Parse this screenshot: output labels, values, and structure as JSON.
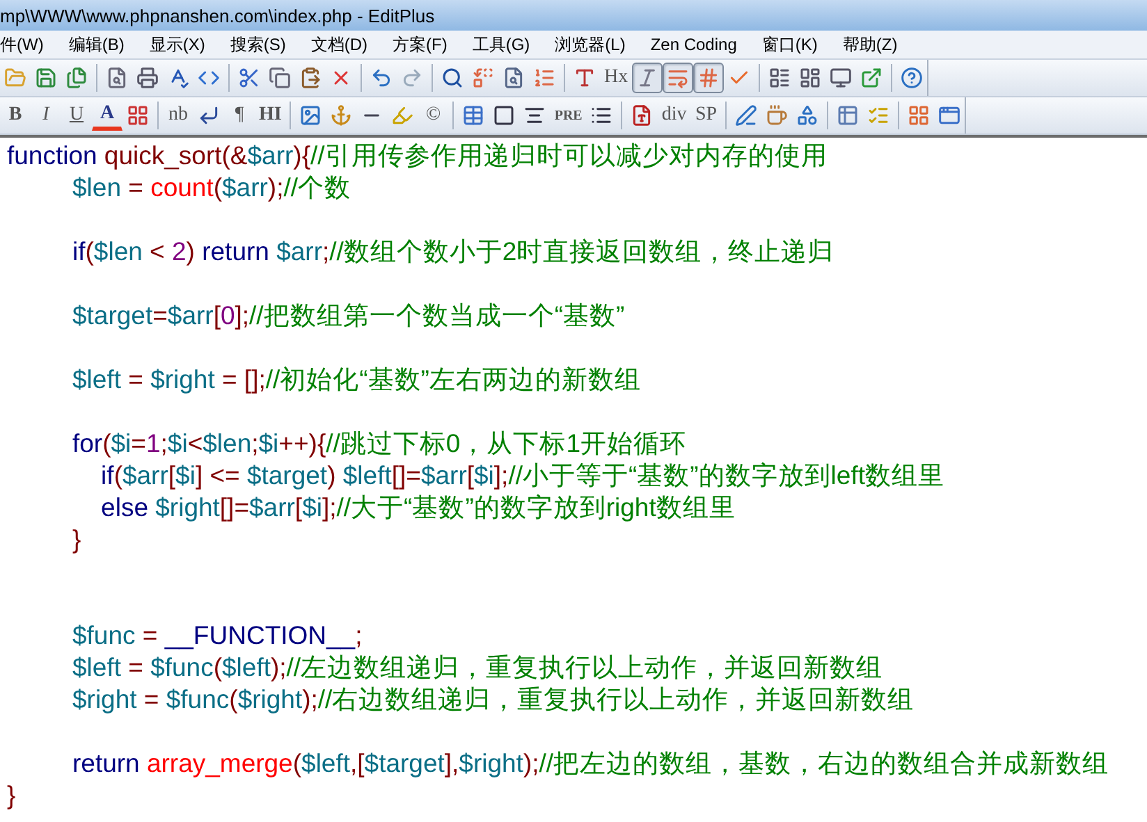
{
  "window": {
    "title": "mp\\WWW\\www.phpnanshen.com\\index.php - EditPlus"
  },
  "menu": [
    "件(W)",
    "编辑(B)",
    "显示(X)",
    "搜索(S)",
    "文档(D)",
    "方案(F)",
    "工具(G)",
    "浏览器(L)",
    "Zen Coding",
    "窗口(K)",
    "帮助(Z)"
  ],
  "toolbar_1": [
    {
      "kind": "icon"
    },
    {
      "kind": "icon"
    },
    {
      "kind": "icon"
    },
    {
      "kind": "sep"
    },
    {
      "kind": "icon"
    },
    {
      "kind": "icon"
    },
    {
      "kind": "icon"
    },
    {
      "kind": "icon"
    },
    {
      "kind": "sep"
    },
    {
      "kind": "icon"
    },
    {
      "kind": "icon"
    },
    {
      "kind": "icon"
    },
    {
      "kind": "icon"
    },
    {
      "kind": "sep"
    },
    {
      "kind": "icon"
    },
    {
      "kind": "icon"
    },
    {
      "kind": "sep"
    },
    {
      "kind": "icon"
    },
    {
      "kind": "icon"
    },
    {
      "kind": "icon"
    },
    {
      "kind": "icon"
    },
    {
      "kind": "sep"
    },
    {
      "kind": "icon"
    },
    {
      "kind": "text",
      "label": "Hx"
    },
    {
      "kind": "toggle",
      "selected": true
    },
    {
      "kind": "toggle",
      "selected": true
    },
    {
      "kind": "toggle",
      "selected": true
    },
    {
      "kind": "icon"
    },
    {
      "kind": "sep"
    },
    {
      "kind": "icon"
    },
    {
      "kind": "icon"
    },
    {
      "kind": "icon"
    },
    {
      "kind": "icon"
    },
    {
      "kind": "sep"
    },
    {
      "kind": "icon"
    }
  ],
  "toolbar_2": [
    {
      "kind": "text",
      "label": "B"
    },
    {
      "kind": "text",
      "label": "I"
    },
    {
      "kind": "text",
      "label": "U"
    },
    {
      "kind": "text",
      "label": "A"
    },
    {
      "kind": "icon"
    },
    {
      "kind": "sep"
    },
    {
      "kind": "text",
      "label": "nb"
    },
    {
      "kind": "icon"
    },
    {
      "kind": "text",
      "label": "¶"
    },
    {
      "kind": "text",
      "label": "HI"
    },
    {
      "kind": "sep"
    },
    {
      "kind": "icon"
    },
    {
      "kind": "icon"
    },
    {
      "kind": "icon"
    },
    {
      "kind": "icon"
    },
    {
      "kind": "text",
      "label": "©"
    },
    {
      "kind": "sep"
    },
    {
      "kind": "icon"
    },
    {
      "kind": "icon"
    },
    {
      "kind": "icon"
    },
    {
      "kind": "text",
      "label": "PRE"
    },
    {
      "kind": "icon"
    },
    {
      "kind": "sep"
    },
    {
      "kind": "icon"
    },
    {
      "kind": "text",
      "label": "div"
    },
    {
      "kind": "text",
      "label": "SP"
    },
    {
      "kind": "sep"
    },
    {
      "kind": "icon"
    },
    {
      "kind": "icon"
    },
    {
      "kind": "icon"
    },
    {
      "kind": "sep"
    },
    {
      "kind": "icon"
    },
    {
      "kind": "icon"
    },
    {
      "kind": "sep"
    },
    {
      "kind": "icon"
    },
    {
      "kind": "icon"
    }
  ],
  "editor": {
    "lines": [
      {
        "kind": "code",
        "tokens": [
          {
            "text": "function",
            "kind": "keyword"
          },
          {
            "text": " quick_sort",
            "kind": "name"
          },
          {
            "text": "(&",
            "kind": "operator"
          },
          {
            "text": "$arr",
            "kind": "variable"
          },
          {
            "text": "){",
            "kind": "operator"
          },
          {
            "text": "//引用传参作用递归时可以减少对内存的使用",
            "kind": "comment"
          }
        ]
      },
      {
        "kind": "code",
        "tokens": [
          {
            "text": "\t$len",
            "kind": "variable"
          },
          {
            "text": " = ",
            "kind": "operator"
          },
          {
            "text": "count",
            "kind": "builtin"
          },
          {
            "text": "(",
            "kind": "operator"
          },
          {
            "text": "$arr",
            "kind": "variable"
          },
          {
            "text": ");",
            "kind": "operator"
          },
          {
            "text": "//个数",
            "kind": "comment"
          }
        ]
      },
      {
        "kind": "blank"
      },
      {
        "kind": "code",
        "tokens": [
          {
            "text": "\tif",
            "kind": "keyword"
          },
          {
            "text": "(",
            "kind": "operator"
          },
          {
            "text": "$len",
            "kind": "variable"
          },
          {
            "text": " < ",
            "kind": "operator"
          },
          {
            "text": "2",
            "kind": "number"
          },
          {
            "text": ") ",
            "kind": "operator"
          },
          {
            "text": "return ",
            "kind": "keyword"
          },
          {
            "text": "$arr",
            "kind": "variable"
          },
          {
            "text": ";",
            "kind": "operator"
          },
          {
            "text": "//数组个数小于2时直接返回数组，终止递归",
            "kind": "comment"
          }
        ]
      },
      {
        "kind": "blank"
      },
      {
        "kind": "code",
        "tokens": [
          {
            "text": "\t$target",
            "kind": "variable"
          },
          {
            "text": "=",
            "kind": "operator"
          },
          {
            "text": "$arr",
            "kind": "variable"
          },
          {
            "text": "[",
            "kind": "operator"
          },
          {
            "text": "0",
            "kind": "number"
          },
          {
            "text": "];",
            "kind": "operator"
          },
          {
            "text": "//把数组第一个数当成一个“基数”",
            "kind": "comment"
          }
        ]
      },
      {
        "kind": "blank"
      },
      {
        "kind": "code",
        "tokens": [
          {
            "text": "\t$left",
            "kind": "variable"
          },
          {
            "text": " = ",
            "kind": "operator"
          },
          {
            "text": "$right",
            "kind": "variable"
          },
          {
            "text": " = [];",
            "kind": "operator"
          },
          {
            "text": "//初始化“基数”左右两边的新数组",
            "kind": "comment"
          }
        ]
      },
      {
        "kind": "blank"
      },
      {
        "kind": "code",
        "tokens": [
          {
            "text": "\tfor",
            "kind": "keyword"
          },
          {
            "text": "(",
            "kind": "operator"
          },
          {
            "text": "$i",
            "kind": "variable"
          },
          {
            "text": "=",
            "kind": "operator"
          },
          {
            "text": "1",
            "kind": "number"
          },
          {
            "text": ";",
            "kind": "operator"
          },
          {
            "text": "$i",
            "kind": "variable"
          },
          {
            "text": "<",
            "kind": "operator"
          },
          {
            "text": "$len",
            "kind": "variable"
          },
          {
            "text": ";",
            "kind": "operator"
          },
          {
            "text": "$i",
            "kind": "variable"
          },
          {
            "text": "++){",
            "kind": "operator"
          },
          {
            "text": "//跳过下标0，从下标1开始循环",
            "kind": "comment"
          }
        ]
      },
      {
        "kind": "code",
        "tokens": [
          {
            "text": "\t    if",
            "kind": "keyword"
          },
          {
            "text": "(",
            "kind": "operator"
          },
          {
            "text": "$arr",
            "kind": "variable"
          },
          {
            "text": "[",
            "kind": "operator"
          },
          {
            "text": "$i",
            "kind": "variable"
          },
          {
            "text": "] <= ",
            "kind": "operator"
          },
          {
            "text": "$target",
            "kind": "variable"
          },
          {
            "text": ") ",
            "kind": "operator"
          },
          {
            "text": "$left",
            "kind": "variable"
          },
          {
            "text": "[]=",
            "kind": "operator"
          },
          {
            "text": "$arr",
            "kind": "variable"
          },
          {
            "text": "[",
            "kind": "operator"
          },
          {
            "text": "$i",
            "kind": "variable"
          },
          {
            "text": "];",
            "kind": "operator"
          },
          {
            "text": "//小于等于“基数”的数字放到left数组里",
            "kind": "comment"
          }
        ]
      },
      {
        "kind": "code",
        "tokens": [
          {
            "text": "\t    else ",
            "kind": "keyword"
          },
          {
            "text": "$right",
            "kind": "variable"
          },
          {
            "text": "[]=",
            "kind": "operator"
          },
          {
            "text": "$arr",
            "kind": "variable"
          },
          {
            "text": "[",
            "kind": "operator"
          },
          {
            "text": "$i",
            "kind": "variable"
          },
          {
            "text": "];",
            "kind": "operator"
          },
          {
            "text": "//大于“基数”的数字放到right数组里",
            "kind": "comment"
          }
        ]
      },
      {
        "kind": "code",
        "tokens": [
          {
            "text": "\t}",
            "kind": "operator"
          }
        ]
      },
      {
        "kind": "blank"
      },
      {
        "kind": "blank"
      },
      {
        "kind": "code",
        "tokens": [
          {
            "text": "\t$func",
            "kind": "variable"
          },
          {
            "text": " = ",
            "kind": "operator"
          },
          {
            "text": "__FUNCTION__",
            "kind": "keyword"
          },
          {
            "text": ";",
            "kind": "operator"
          }
        ]
      },
      {
        "kind": "code",
        "tokens": [
          {
            "text": "\t$left",
            "kind": "variable"
          },
          {
            "text": " = ",
            "kind": "operator"
          },
          {
            "text": "$func",
            "kind": "variable"
          },
          {
            "text": "(",
            "kind": "operator"
          },
          {
            "text": "$left",
            "kind": "variable"
          },
          {
            "text": ");",
            "kind": "operator"
          },
          {
            "text": "//左边数组递归，重复执行以上动作，并返回新数组",
            "kind": "comment"
          }
        ]
      },
      {
        "kind": "code",
        "tokens": [
          {
            "text": "\t$right",
            "kind": "variable"
          },
          {
            "text": " = ",
            "kind": "operator"
          },
          {
            "text": "$func",
            "kind": "variable"
          },
          {
            "text": "(",
            "kind": "operator"
          },
          {
            "text": "$right",
            "kind": "variable"
          },
          {
            "text": ");",
            "kind": "operator"
          },
          {
            "text": "//右边数组递归，重复执行以上动作，并返回新数组",
            "kind": "comment"
          }
        ]
      },
      {
        "kind": "blank"
      },
      {
        "kind": "code",
        "tokens": [
          {
            "text": "\treturn ",
            "kind": "keyword"
          },
          {
            "text": "array_merge",
            "kind": "builtin"
          },
          {
            "text": "(",
            "kind": "operator"
          },
          {
            "text": "$left",
            "kind": "variable"
          },
          {
            "text": ",[",
            "kind": "operator"
          },
          {
            "text": "$target",
            "kind": "variable"
          },
          {
            "text": "],",
            "kind": "operator"
          },
          {
            "text": "$right",
            "kind": "variable"
          },
          {
            "text": ");",
            "kind": "operator"
          },
          {
            "text": "//把左边的数组，基数，右边的数组合并成新数组",
            "kind": "comment"
          }
        ]
      },
      {
        "kind": "code",
        "tokens": [
          {
            "text": "}",
            "kind": "operator"
          }
        ]
      }
    ]
  }
}
